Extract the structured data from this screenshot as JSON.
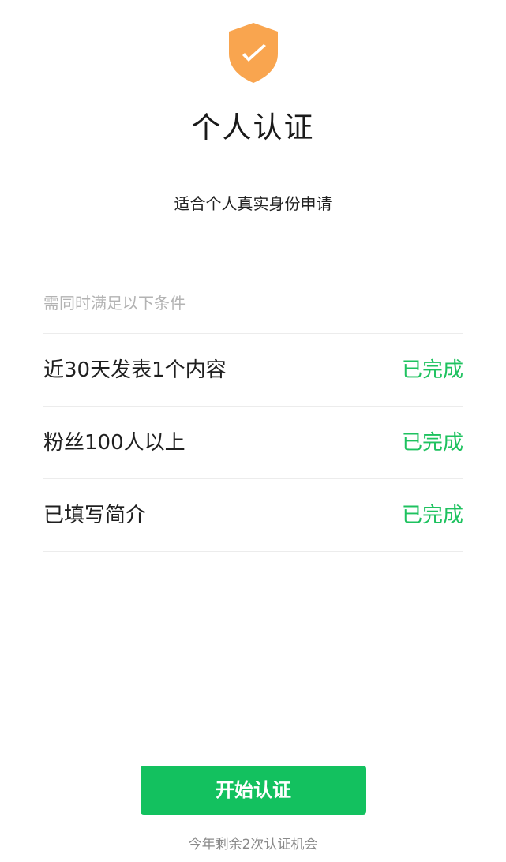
{
  "header": {
    "icon": "shield-check-icon",
    "icon_color": "#f9a54f",
    "title": "个人认证",
    "subtitle": "适合个人真实身份申请"
  },
  "conditions": {
    "header": "需同时满足以下条件",
    "status_color": "#1ec25f",
    "items": [
      {
        "label": "近30天发表1个内容",
        "status": "已完成"
      },
      {
        "label": "粉丝100人以上",
        "status": "已完成"
      },
      {
        "label": "已填写简介",
        "status": "已完成"
      }
    ]
  },
  "footer": {
    "button_label": "开始认证",
    "button_color": "#13c15f",
    "remaining_text": "今年剩余2次认证机会"
  }
}
